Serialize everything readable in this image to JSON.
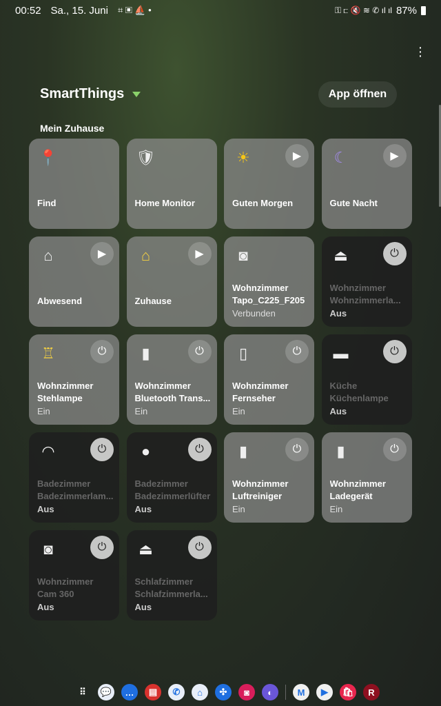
{
  "status": {
    "time": "00:52",
    "date": "Sa., 15. Juni",
    "battery": "87%",
    "left_icons": [
      "screenshot-icon",
      "gallery-icon",
      "sleep-icon",
      "dot-icon"
    ],
    "right_icons": [
      "key-icon",
      "bed-icon",
      "mute-icon",
      "wifi-icon",
      "wifi-call-icon",
      "signal-icon",
      "signal-icon",
      "battery-icon"
    ]
  },
  "header": {
    "app_title": "SmartThings",
    "open_app": "App öffnen",
    "section": "Mein Zuhause"
  },
  "tiles": [
    {
      "lines": [
        "Find"
      ],
      "icon": "location-pin-icon",
      "glyph": "📍",
      "style": "light",
      "button": null
    },
    {
      "lines": [
        "Home Monitor"
      ],
      "icon": "shield-icon",
      "glyph": "🛡",
      "style": "light",
      "button": null
    },
    {
      "lines": [
        "Guten Morgen"
      ],
      "icon": "sun-icon",
      "glyph": "☀",
      "color": "#f5c518",
      "style": "light",
      "button": "play"
    },
    {
      "lines": [
        "Gute Nacht"
      ],
      "icon": "moon-icon",
      "glyph": "☾",
      "color": "#a58cf0",
      "style": "light",
      "button": "play"
    },
    {
      "lines": [
        "Abwesend"
      ],
      "icon": "house-icon",
      "glyph": "⌂",
      "style": "light",
      "button": "play"
    },
    {
      "lines": [
        "Zuhause"
      ],
      "icon": "house-icon",
      "glyph": "⌂",
      "color": "#f5d142",
      "style": "light",
      "button": "play"
    },
    {
      "lines": [
        "Wohnzimmer",
        "Tapo_C225_F205"
      ],
      "status": "Verbunden",
      "icon": "camera-icon",
      "glyph": "◙",
      "style": "light",
      "button": null
    },
    {
      "lines": [
        "Wohnzimmer",
        "Wohnzimmerla..."
      ],
      "status": "Aus",
      "icon": "ceiling-lamp-icon",
      "glyph": "⏏",
      "style": "off",
      "button": "power"
    },
    {
      "lines": [
        "Wohnzimmer",
        "Stehlampe"
      ],
      "status": "Ein",
      "icon": "floor-lamp-icon",
      "glyph": "♖",
      "color": "#f5d142",
      "style": "light",
      "button": "power"
    },
    {
      "lines": [
        "Wohnzimmer",
        "Bluetooth Trans..."
      ],
      "status": "Ein",
      "icon": "plug-icon",
      "glyph": "▮",
      "style": "light",
      "button": "power"
    },
    {
      "lines": [
        "Wohnzimmer",
        "Fernseher"
      ],
      "status": "Ein",
      "icon": "remote-icon",
      "glyph": "▯",
      "style": "light",
      "button": "power"
    },
    {
      "lines": [
        "Küche",
        "Küchenlampe"
      ],
      "status": "Aus",
      "icon": "panel-light-icon",
      "glyph": "▬",
      "style": "off",
      "button": "power"
    },
    {
      "lines": [
        "Badezimmer",
        "Badezimmerlam..."
      ],
      "status": "Aus",
      "icon": "ceiling-lamp-icon",
      "glyph": "◠",
      "style": "off",
      "button": "power"
    },
    {
      "lines": [
        "Badezimmer",
        "Badezimmerlüfter"
      ],
      "status": "Aus",
      "icon": "bulb-icon",
      "glyph": "●",
      "style": "off",
      "button": "power"
    },
    {
      "lines": [
        "Wohnzimmer",
        "Luftreiniger"
      ],
      "status": "Ein",
      "icon": "plug-icon",
      "glyph": "▮",
      "style": "light",
      "button": "power"
    },
    {
      "lines": [
        "Wohnzimmer",
        "Ladegerät"
      ],
      "status": "Ein",
      "icon": "plug-icon",
      "glyph": "▮",
      "style": "light",
      "button": "power"
    },
    {
      "lines": [
        "Wohnzimmer",
        "Cam 360"
      ],
      "status": "Aus",
      "icon": "camera-icon",
      "glyph": "◙",
      "style": "off",
      "button": "power"
    },
    {
      "lines": [
        "Schlafzimmer",
        "Schlafzimmerla..."
      ],
      "status": "Aus",
      "icon": "ceiling-lamp-icon",
      "glyph": "⏏",
      "style": "off",
      "button": "power"
    }
  ],
  "dock": [
    {
      "name": "apps-grid",
      "glyph": "⠿",
      "bg": "transparent"
    },
    {
      "name": "messages",
      "glyph": "💬",
      "bg": "#e8eef8"
    },
    {
      "name": "samsung-messages",
      "glyph": "…",
      "bg": "#1f6fe0"
    },
    {
      "name": "notes",
      "glyph": "▤",
      "bg": "#d8322e"
    },
    {
      "name": "phone",
      "glyph": "✆",
      "bg": "#e8eef8"
    },
    {
      "name": "smarthome",
      "glyph": "⌂",
      "bg": "#e8eef8"
    },
    {
      "name": "smartthings",
      "glyph": "✣",
      "bg": "#1f6fe0"
    },
    {
      "name": "camera",
      "glyph": "◙",
      "bg": "#d81e5b"
    },
    {
      "name": "internet",
      "glyph": "◐",
      "bg": "#6a56d8"
    },
    {
      "name": "gmail",
      "glyph": "M",
      "bg": "#f0f0f0"
    },
    {
      "name": "play-store",
      "glyph": "▶",
      "bg": "#f0f0f0"
    },
    {
      "name": "galaxy-store",
      "glyph": "🛍",
      "bg": "#e8264e"
    },
    {
      "name": "r-app",
      "glyph": "R",
      "bg": "#8e1020"
    }
  ]
}
